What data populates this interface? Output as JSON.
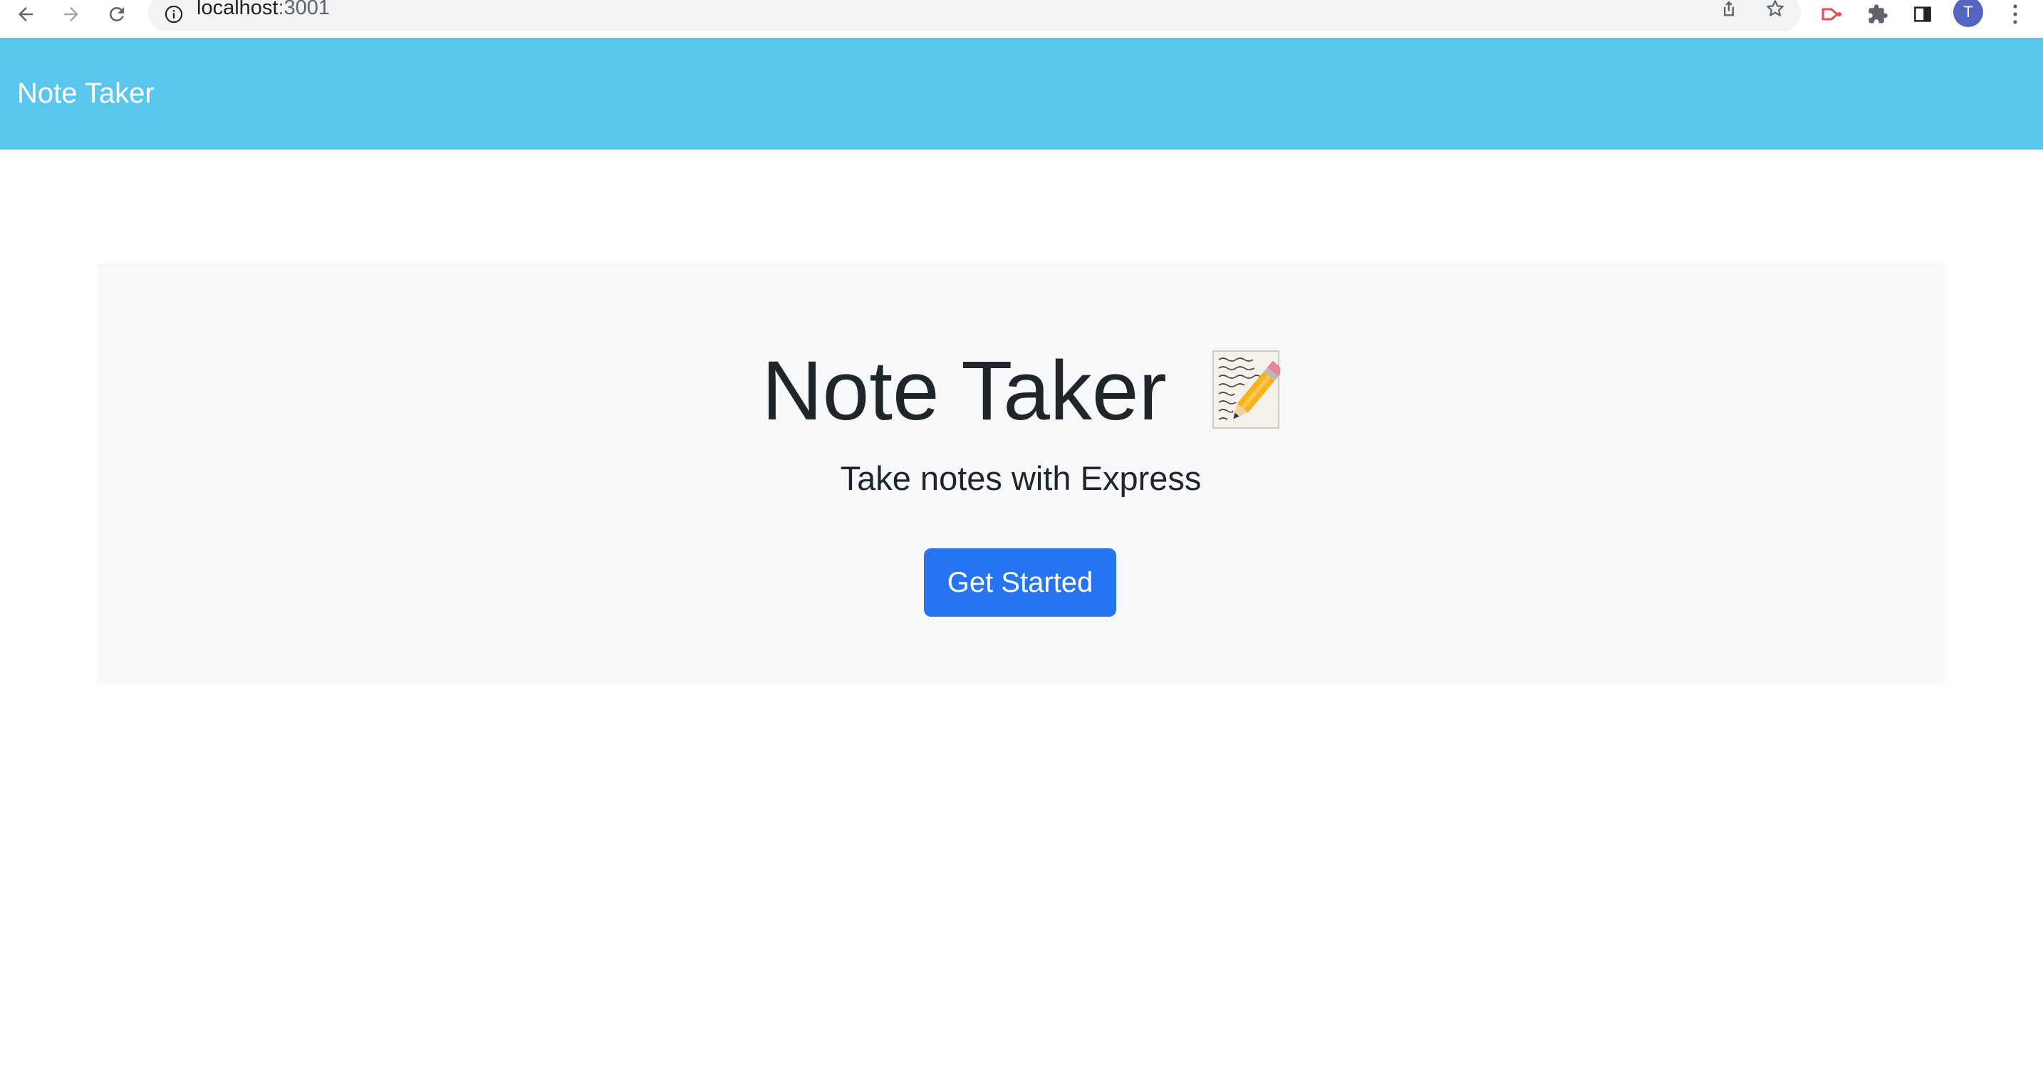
{
  "browser": {
    "url_host": "localhost",
    "url_port": ":3001",
    "profile_initial": "T"
  },
  "navbar": {
    "brand": "Note Taker",
    "color": "#5bc6ed"
  },
  "hero": {
    "title": "Note Taker",
    "title_icon": "memo-icon",
    "lead": "Take notes with Express",
    "cta_label": "Get Started",
    "cta_color": "#2774f0"
  }
}
